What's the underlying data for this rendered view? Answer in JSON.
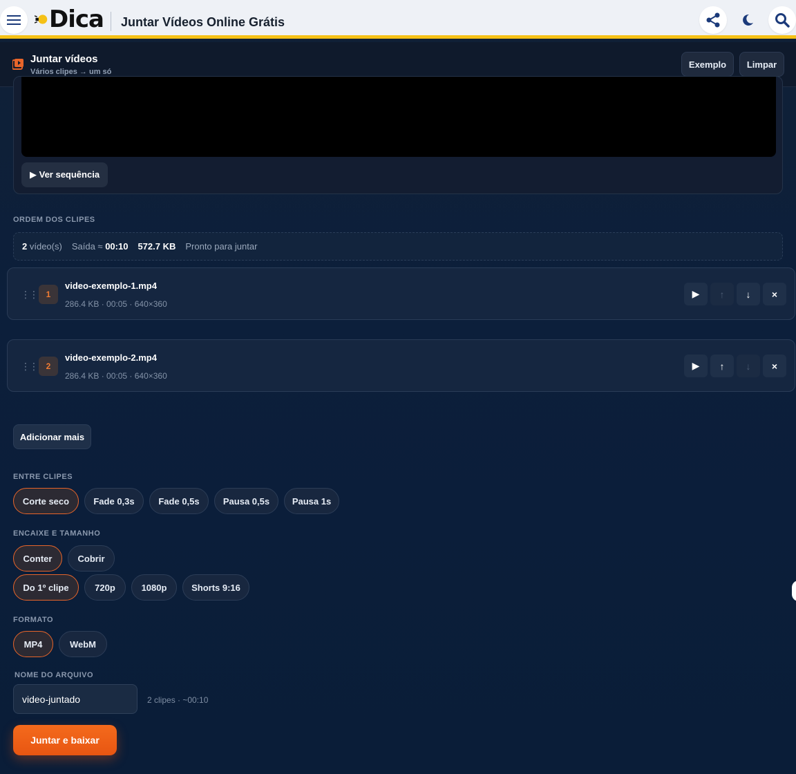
{
  "header": {
    "logo_text": "Dica",
    "page_title": "Juntar Vídeos Online Grátis"
  },
  "tool": {
    "title": "Juntar vídeos",
    "subtitle": "Vários clipes → um só",
    "example_label": "Exemplo",
    "clear_label": "Limpar"
  },
  "preview": {
    "sequence_label": "▶ Ver sequência"
  },
  "order": {
    "section_label": "ORDEM DOS CLIPES",
    "count_value": "2",
    "count_suffix": "vídeo(s)",
    "output_label": "Saída ≈",
    "output_duration": "00:10",
    "total_size": "572.7 KB",
    "status": "Pronto para juntar"
  },
  "clips": [
    {
      "num": "1",
      "name": "video-exemplo-1.mp4",
      "meta": "286.4 KB · 00:05 · 640×360"
    },
    {
      "num": "2",
      "name": "video-exemplo-2.mp4",
      "meta": "286.4 KB · 00:05 · 640×360"
    }
  ],
  "clip_buttons": {
    "play": "▶",
    "up": "↑",
    "down": "↓",
    "remove": "×"
  },
  "add_more_label": "Adicionar mais",
  "transitions": {
    "section_label": "ENTRE CLIPES",
    "options": [
      "Corte seco",
      "Fade 0,3s",
      "Fade 0,5s",
      "Pausa 0,5s",
      "Pausa 1s"
    ],
    "selected": "Corte seco"
  },
  "fit": {
    "section_label": "ENCAIXE E TAMANHO",
    "fit_options": [
      "Conter",
      "Cobrir"
    ],
    "fit_selected": "Conter",
    "size_options": [
      "Do 1º clipe",
      "720p",
      "1080p",
      "Shorts 9:16"
    ],
    "size_selected": "Do 1º clipe"
  },
  "format": {
    "section_label": "FORMATO",
    "options": [
      "MP4",
      "WebM"
    ],
    "selected": "MP4"
  },
  "filename": {
    "section_label": "NOME DO ARQUIVO",
    "value": "video-juntado",
    "info": "2 clipes · ~00:10"
  },
  "join_label": "Juntar e baixar",
  "colors": {
    "accent": "#e8652a",
    "header_bar": "#f5c116",
    "join_button": "#f46a1c"
  }
}
